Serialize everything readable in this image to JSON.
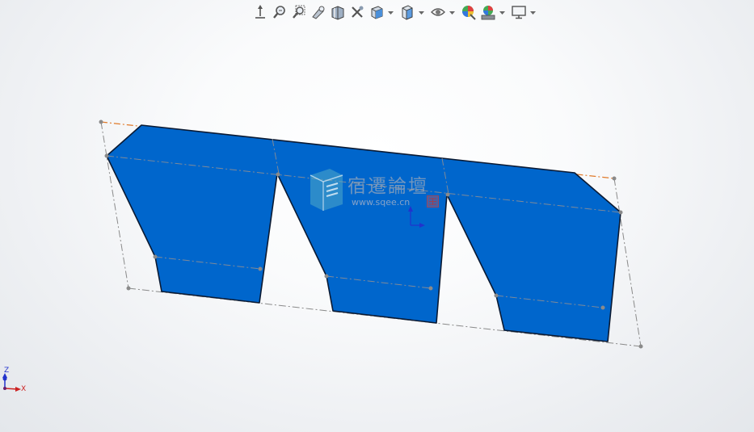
{
  "window": {
    "view": "graphics-area"
  },
  "toolbar": {
    "buttons": [
      {
        "name": "view-orientation",
        "icon": "view-orientation-icon",
        "has_dropdown": false
      },
      {
        "name": "zoom-to-fit",
        "icon": "zoom-to-fit-icon",
        "has_dropdown": false
      },
      {
        "name": "zoom-to-area",
        "icon": "zoom-to-area-icon",
        "has_dropdown": false
      },
      {
        "name": "previous-view",
        "icon": "previous-view-icon",
        "has_dropdown": false
      },
      {
        "name": "section-view",
        "icon": "section-view-icon",
        "has_dropdown": false
      },
      {
        "name": "dynamic-annotation",
        "icon": "dynamic-annotation-icon",
        "has_dropdown": false
      },
      {
        "name": "view-orientation-menu",
        "icon": "cube-view-icon",
        "has_dropdown": true
      },
      {
        "name": "display-style",
        "icon": "display-style-icon",
        "has_dropdown": true
      },
      {
        "name": "hide-show-items",
        "icon": "eye-icon",
        "has_dropdown": true
      },
      {
        "name": "edit-appearance",
        "icon": "edit-appearance-icon",
        "has_dropdown": false
      },
      {
        "name": "apply-scene",
        "icon": "apply-scene-icon",
        "has_dropdown": true
      },
      {
        "name": "view-settings",
        "icon": "monitor-icon",
        "has_dropdown": true
      }
    ]
  },
  "watermark": {
    "title": "宿遷論壇",
    "url": "www.sqee.cn"
  },
  "triad": {
    "axis_y": "Z",
    "axis_x": "X"
  },
  "colors": {
    "part_fill": "#0066cc",
    "part_edge": "#0a1a33",
    "sketch_line": "#8a8a8a",
    "highlight_line": "#e07a2a",
    "axis_x": "#cc2222",
    "axis_z": "#2233cc"
  }
}
